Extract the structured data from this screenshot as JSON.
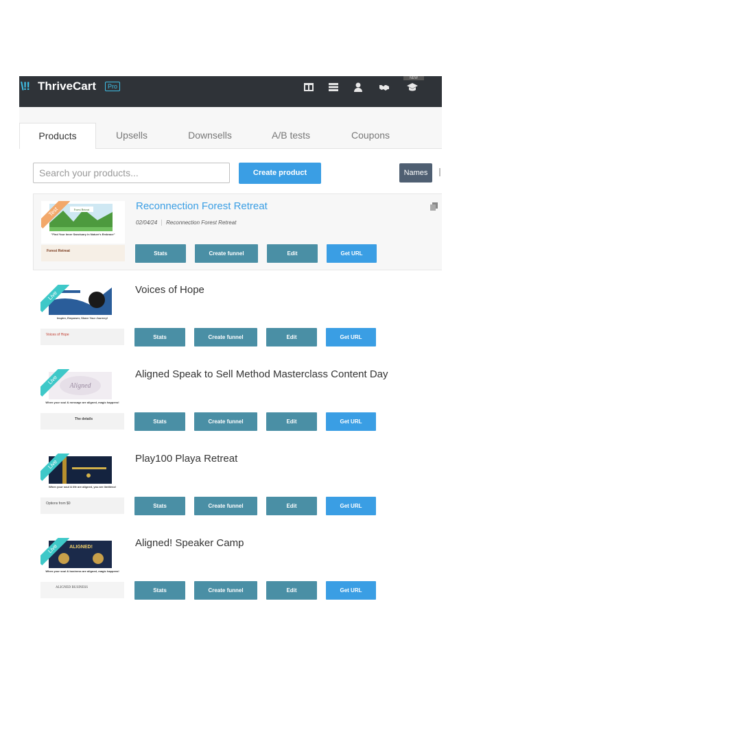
{
  "header": {
    "logo_bars": "\\!!",
    "logo_text": "ThriveCart",
    "logo_badge": "Pro",
    "icons": [
      "columns-icon",
      "table-icon",
      "user-icon",
      "handshake-icon",
      "graduation-cap-icon"
    ],
    "badge_text": "NEW"
  },
  "tabs": [
    "Products",
    "Upsells",
    "Downsells",
    "A/B tests",
    "Coupons"
  ],
  "toolbar": {
    "search_placeholder": "Search your products...",
    "create_label": "Create product",
    "names_label": "Names"
  },
  "actions": {
    "stats": "Stats",
    "funnel": "Create funnel",
    "edit": "Edit",
    "url": "Get URL"
  },
  "products": [
    {
      "title": "Reconnection Forest Retreat",
      "status": "Test",
      "date": "02/04/24",
      "label": "Reconnection Forest Retreat",
      "thumb_caption": "\"Find Your Inner Sanctuary in Nature's Embrace\"",
      "thumb_bottom": "Forest Retreat"
    },
    {
      "title": "Voices of Hope",
      "status": "Live",
      "thumb_caption": "Inspire, Empower, Share Your Journey!",
      "thumb_bottom": "Voices of Hope"
    },
    {
      "title": "Aligned Speak to Sell Method Masterclass Content Day",
      "status": "Live",
      "thumb_caption": "When your soul & message are aligned, magic happens!",
      "thumb_bottom": "The details"
    },
    {
      "title": "Play100 Playa Retreat",
      "status": "Live",
      "thumb_caption": "When your soul & life are aligned, you are limitless!",
      "thumb_bottom": "Options from $0"
    },
    {
      "title": "Aligned! Speaker Camp",
      "status": "Live",
      "thumb_caption": "When your soul & business are aligned, magic happens!",
      "thumb_bottom": "ALIGNED BUSINESS"
    }
  ],
  "colors": {
    "topbar": "#2f3338",
    "accent": "#3a9ee4",
    "action": "#4a8fa5",
    "test_ribbon": "#f2a86a",
    "live_ribbon": "#3ec8c8"
  }
}
